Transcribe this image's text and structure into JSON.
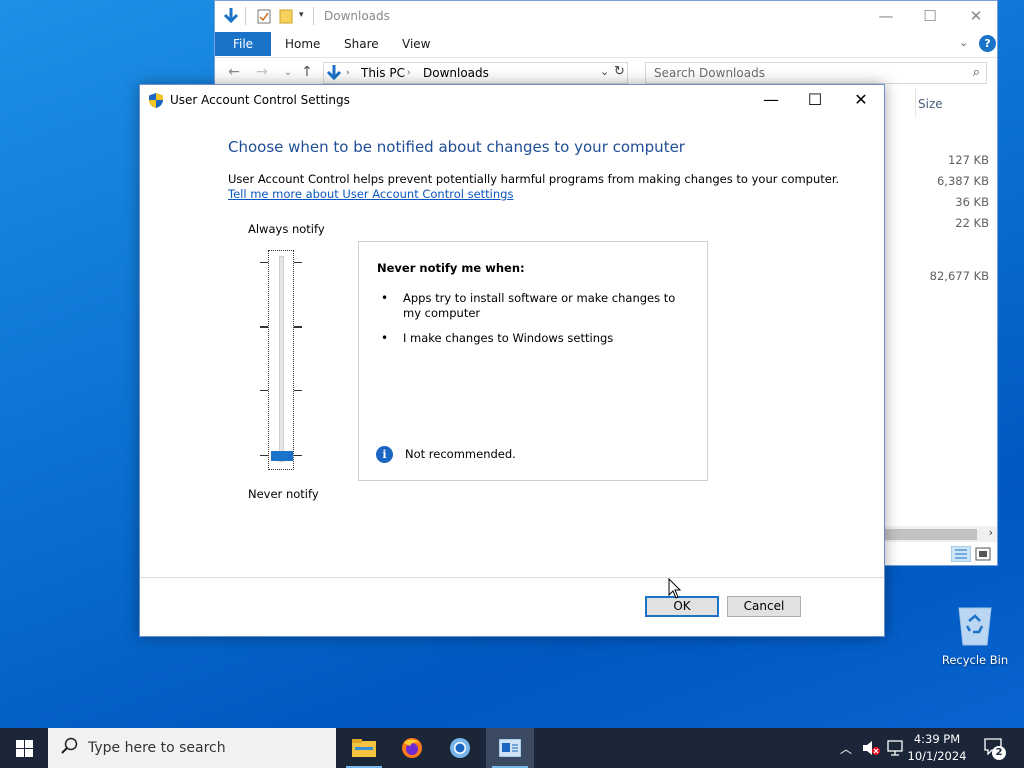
{
  "explorer": {
    "title": "Downloads",
    "ribbon_tabs": {
      "file": "File",
      "home": "Home",
      "share": "Share",
      "view": "View"
    },
    "help": "?",
    "path": {
      "root": "This PC",
      "folder": "Downloads"
    },
    "search_placeholder": "Search Downloads",
    "column_size": "Size",
    "sizes": [
      "127 KB",
      "6,387 KB",
      "36 KB",
      "22 KB",
      "82,677 KB"
    ]
  },
  "uac": {
    "title": "User Account Control Settings",
    "heading": "Choose when to be notified about changes to your computer",
    "description": "User Account Control helps prevent potentially harmful programs from making changes to your computer.",
    "link": "Tell me more about User Account Control settings",
    "always_notify": "Always notify",
    "never_notify": "Never notify",
    "slider_level": 0,
    "slider_levels_total": 4,
    "info": {
      "heading": "Never notify me when:",
      "bullets": [
        "Apps try to install software or make changes to my computer",
        "I make changes to Windows settings"
      ],
      "note": "Not recommended."
    },
    "ok": "OK",
    "cancel": "Cancel"
  },
  "desktop": {
    "recycle_bin": "Recycle Bin"
  },
  "taskbar": {
    "search_placeholder": "Type here to search",
    "time": "4:39 PM",
    "date": "10/1/2024",
    "notifications": "2"
  }
}
